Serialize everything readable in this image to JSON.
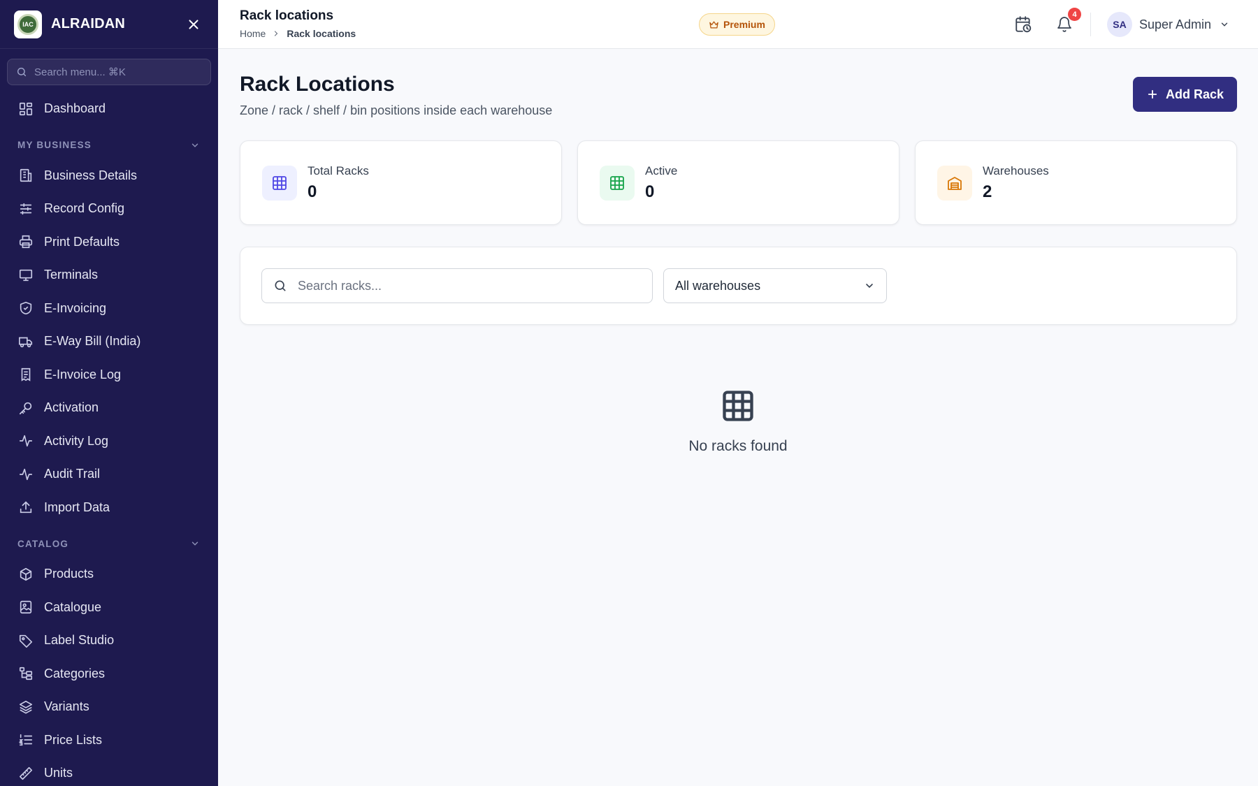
{
  "brand": {
    "name": "ALRAIDAN",
    "logo_text": "IAC"
  },
  "sidebar": {
    "search_placeholder": "Search menu... ⌘K",
    "top_item": {
      "label": "Dashboard",
      "icon": "dashboard-icon"
    },
    "sections": [
      {
        "title": "MY BUSINESS",
        "items": [
          {
            "label": "Business Details",
            "icon": "building-icon"
          },
          {
            "label": "Record Config",
            "icon": "sliders-icon"
          },
          {
            "label": "Print Defaults",
            "icon": "printer-icon"
          },
          {
            "label": "Terminals",
            "icon": "monitor-icon"
          },
          {
            "label": "E-Invoicing",
            "icon": "shield-check-icon"
          },
          {
            "label": "E-Way Bill (India)",
            "icon": "truck-icon"
          },
          {
            "label": "E-Invoice Log",
            "icon": "receipt-icon"
          },
          {
            "label": "Activation",
            "icon": "key-icon"
          },
          {
            "label": "Activity Log",
            "icon": "activity-icon"
          },
          {
            "label": "Audit Trail",
            "icon": "activity-icon"
          },
          {
            "label": "Import Data",
            "icon": "upload-icon"
          }
        ]
      },
      {
        "title": "CATALOG",
        "items": [
          {
            "label": "Products",
            "icon": "box-icon"
          },
          {
            "label": "Catalogue",
            "icon": "image-icon"
          },
          {
            "label": "Label Studio",
            "icon": "tag-icon"
          },
          {
            "label": "Categories",
            "icon": "folder-tree-icon"
          },
          {
            "label": "Variants",
            "icon": "layers-icon"
          },
          {
            "label": "Price Lists",
            "icon": "list-ordered-icon"
          },
          {
            "label": "Units",
            "icon": "ruler-icon"
          }
        ]
      }
    ]
  },
  "header": {
    "title": "Rack locations",
    "breadcrumb": {
      "home": "Home",
      "current": "Rack locations"
    },
    "premium_label": "Premium",
    "notification_count": "4",
    "user": {
      "initials": "SA",
      "name": "Super Admin"
    }
  },
  "main": {
    "title": "Rack Locations",
    "subtitle": "Zone / rack / shelf / bin positions inside each warehouse",
    "add_button_label": "Add Rack",
    "stats": [
      {
        "label": "Total Racks",
        "value": "0",
        "color": "#4f46e5",
        "bg": "#eef0ff"
      },
      {
        "label": "Active",
        "value": "0",
        "color": "#16a34a",
        "bg": "#eafaf0"
      },
      {
        "label": "Warehouses",
        "value": "2",
        "color": "#d97706",
        "bg": "#fff5e6"
      }
    ],
    "search_placeholder": "Search racks...",
    "warehouse_filter": "All warehouses",
    "empty_text": "No racks found"
  },
  "colors": {
    "sidebar_bg": "#1e1a4f",
    "primary": "#312e81",
    "badge": "#ef4444"
  }
}
